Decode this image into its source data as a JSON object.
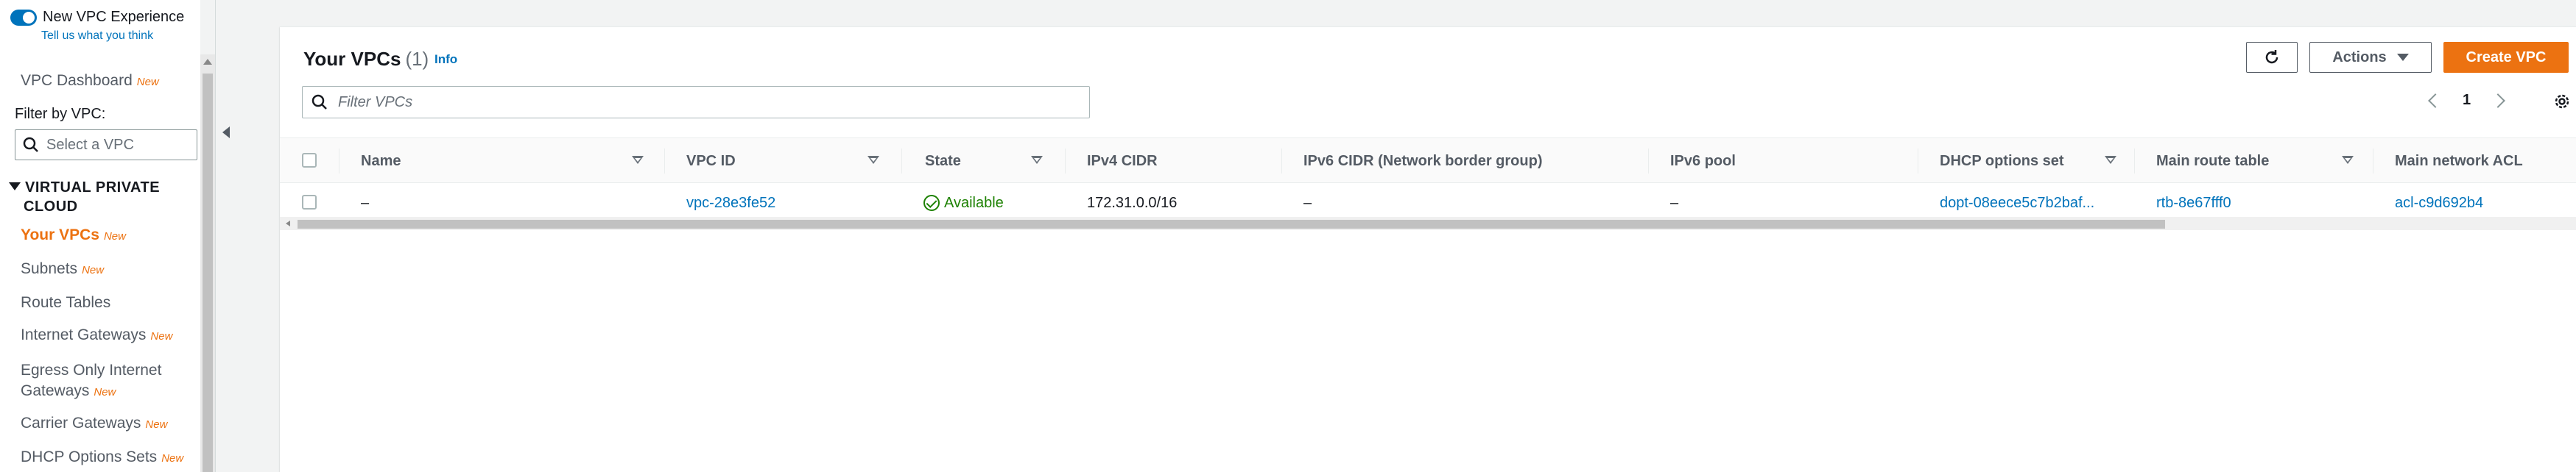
{
  "sidebar": {
    "toggle_label": "New VPC Experience",
    "feedback_link": "Tell us what you think",
    "filter_label": "Filter by VPC:",
    "select_placeholder": "Select a VPC",
    "section_heading_line1": "VIRTUAL PRIVATE",
    "section_heading_line2": "CLOUD",
    "new_badge": "New",
    "items": [
      {
        "label": "VPC Dashboard",
        "badge": "New"
      },
      {
        "label": "Your VPCs",
        "badge": "New",
        "active": true
      },
      {
        "label": "Subnets",
        "badge": "New"
      },
      {
        "label": "Route Tables",
        "badge": ""
      },
      {
        "label": "Internet Gateways",
        "badge": "New"
      },
      {
        "label_line1": "Egress Only Internet",
        "label_line2": "Gateways",
        "badge": "New"
      },
      {
        "label": "Carrier Gateways",
        "badge": "New"
      },
      {
        "label": "DHCP Options Sets",
        "badge": "New"
      }
    ]
  },
  "panel": {
    "title": "Your VPCs",
    "count": "(1)",
    "info": "Info",
    "refresh_icon": "refresh-icon",
    "actions_label": "Actions",
    "create_label": "Create VPC",
    "search_placeholder": "Filter VPCs",
    "page_number": "1"
  },
  "table": {
    "columns": [
      "Name",
      "VPC ID",
      "State",
      "IPv4 CIDR",
      "IPv6 CIDR (Network border group)",
      "IPv6 pool",
      "DHCP options set",
      "Main route table",
      "Main network ACL"
    ],
    "rows": [
      {
        "name": "–",
        "vpc_id": "vpc-28e3fe52",
        "state": "Available",
        "ipv4_cidr": "172.31.0.0/16",
        "ipv6_cidr": "–",
        "ipv6_pool": "–",
        "dhcp_options": "dopt-08eece5c7b2baf...",
        "route_table": "rtb-8e67fff0",
        "network_acl": "acl-c9d692b4"
      }
    ]
  },
  "colors": {
    "accent": "#ec7211",
    "link": "#0073bb",
    "success": "#1d8102"
  }
}
